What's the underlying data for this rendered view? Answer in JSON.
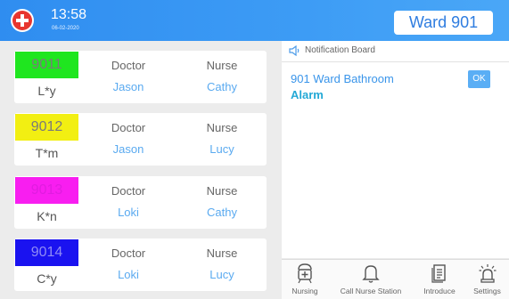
{
  "header": {
    "time": "13:58",
    "date": "06-02-2020",
    "ward": "Ward 901"
  },
  "patients": [
    {
      "bed": "9011",
      "bed_color": "#1fe61f",
      "name": "L*y",
      "doctor_label": "Doctor",
      "doctor": "Jason",
      "nurse_label": "Nurse",
      "nurse": "Cathy"
    },
    {
      "bed": "9012",
      "bed_color": "#f2ef12",
      "name": "T*m",
      "doctor_label": "Doctor",
      "doctor": "Jason",
      "nurse_label": "Nurse",
      "nurse": "Lucy"
    },
    {
      "bed": "9013",
      "bed_color": "#f81ef0",
      "name": "K*n",
      "doctor_label": "Doctor",
      "doctor": "Loki",
      "nurse_label": "Nurse",
      "nurse": "Cathy"
    },
    {
      "bed": "9014",
      "bed_color": "#1a12f0",
      "name": "C*y",
      "doctor_label": "Doctor",
      "doctor": "Loki",
      "nurse_label": "Nurse",
      "nurse": "Lucy"
    }
  ],
  "notification": {
    "title": "Notification Board",
    "message_title": "901 Ward Bathroom",
    "message_subtitle": "Alarm",
    "ok_label": "OK"
  },
  "nav": {
    "nursing": "Nursing",
    "call": "Call Nurse Station",
    "introduce": "Introduce",
    "settings": "Settings"
  }
}
